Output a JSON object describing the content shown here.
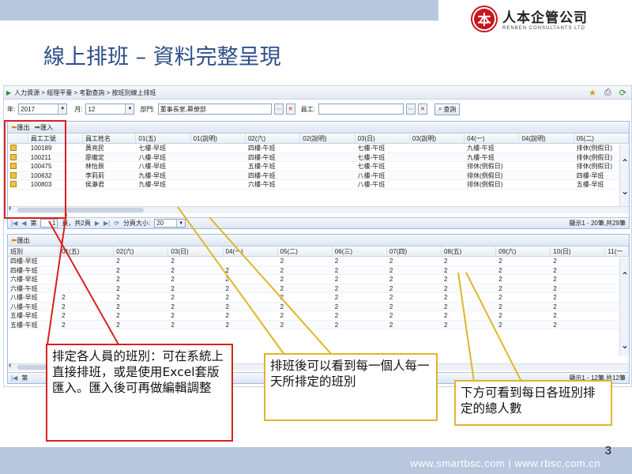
{
  "slide": {
    "title": "線上排班 – 資料完整呈現",
    "page_number": "3",
    "footer": "www.smartbsc.com | www.rbsc.com.cn"
  },
  "logo": {
    "seal": "本",
    "cn": "人本企管公司",
    "en": "RENBEN CONSULTANTS LTD"
  },
  "breadcrumb": "人力資源 > 經理平臺 > 考勤查詢 > 按班別線上排班",
  "filters": {
    "year_label": "年:",
    "year_value": "2017",
    "month_label": "月:",
    "month_value": "12",
    "dept_label": "部門:",
    "dept_value": "董事長室,幕僚部",
    "emp_label": "員工:",
    "emp_value": "",
    "query_label": "查詢"
  },
  "top_panel": {
    "export_label": "匯出",
    "import_label": "匯入",
    "columns": [
      "",
      "員工工號",
      "員工姓名",
      "01(五)",
      "01(說明)",
      "02(六)",
      "02(說明)",
      "03(日)",
      "03(說明)",
      "04(一)",
      "04(說明)",
      "05(二)"
    ],
    "rows": [
      [
        "",
        "100189",
        "黃亮民",
        "七樓-早班",
        "",
        "四樓-午班",
        "",
        "七樓-午班",
        "",
        "九樓-午班",
        "",
        "排休(例假日)"
      ],
      [
        "",
        "100211",
        "廖繼定",
        "八樓-早班",
        "",
        "四樓-午班",
        "",
        "七樓-午班",
        "",
        "九樓-午班",
        "",
        "排休(例假日)"
      ],
      [
        "",
        "100475",
        "林怡辰",
        "八樓-早班",
        "",
        "五樓-午班",
        "",
        "七樓-午班",
        "",
        "排休(例假日)",
        "",
        "排休(例假日)"
      ],
      [
        "",
        "100632",
        "李莉莉",
        "九樓-早班",
        "",
        "四樓-午班",
        "",
        "八樓-午班",
        "",
        "排休(例假日)",
        "",
        "四樓-早班"
      ],
      [
        "",
        "100803",
        "侯瀞君",
        "九樓-早班",
        "",
        "六樓-午班",
        "",
        "八樓-午班",
        "",
        "排休(例假日)",
        "",
        "五樓-早班"
      ]
    ],
    "pager": {
      "page_prefix": "第",
      "page_value": "1",
      "page_suffix": "頁，共2頁",
      "size_label": "分頁大小:",
      "size_value": "20",
      "display": "顯示1 - 20筆,共29筆"
    }
  },
  "bottom_panel": {
    "export_label": "匯出",
    "columns": [
      "班別",
      "01(五)",
      "02(六)",
      "03(日)",
      "04(一)",
      "05(二)",
      "06(三)",
      "07(四)",
      "08(五)",
      "09(六)",
      "10(日)",
      "11(一"
    ],
    "rows": [
      [
        "四樓-早班",
        "",
        "2",
        "2",
        "",
        "2",
        "2",
        "2",
        "2",
        "2",
        "2",
        ""
      ],
      [
        "四樓-午班",
        "",
        "2",
        "2",
        "2",
        "2",
        "2",
        "2",
        "2",
        "2",
        "2",
        ""
      ],
      [
        "六樓-早班",
        "",
        "2",
        "2",
        "2",
        "2",
        "2",
        "2",
        "2",
        "2",
        "2",
        ""
      ],
      [
        "六樓-午班",
        "",
        "2",
        "2",
        "2",
        "2",
        "2",
        "2",
        "2",
        "2",
        "2",
        ""
      ],
      [
        "八樓-早班",
        "2",
        "2",
        "2",
        "2",
        "2",
        "2",
        "2",
        "2",
        "2",
        "2",
        ""
      ],
      [
        "八樓-午班",
        "2",
        "2",
        "2",
        "2",
        "2",
        "2",
        "2",
        "2",
        "2",
        "2",
        ""
      ],
      [
        "五樓-早班",
        "2",
        "2",
        "2",
        "2",
        "2",
        "2",
        "2",
        "2",
        "2",
        "2",
        ""
      ],
      [
        "五樓-午班",
        "2",
        "2",
        "2",
        "2",
        "2",
        "2",
        "2",
        "2",
        "2",
        "2",
        ""
      ]
    ],
    "pager": {
      "page_prefix": "第",
      "display": "顯示1 - 12筆,共12筆"
    }
  },
  "notes": {
    "red": "排定各人員的班別：可在系統上直接排班，或是使用Excel套版匯入。匯入後可再做編輯調整",
    "yellow": "排班後可以看到每一個人每一天所排定的班別",
    "yellow2": "下方可看到每日各班別排定的總人數"
  }
}
